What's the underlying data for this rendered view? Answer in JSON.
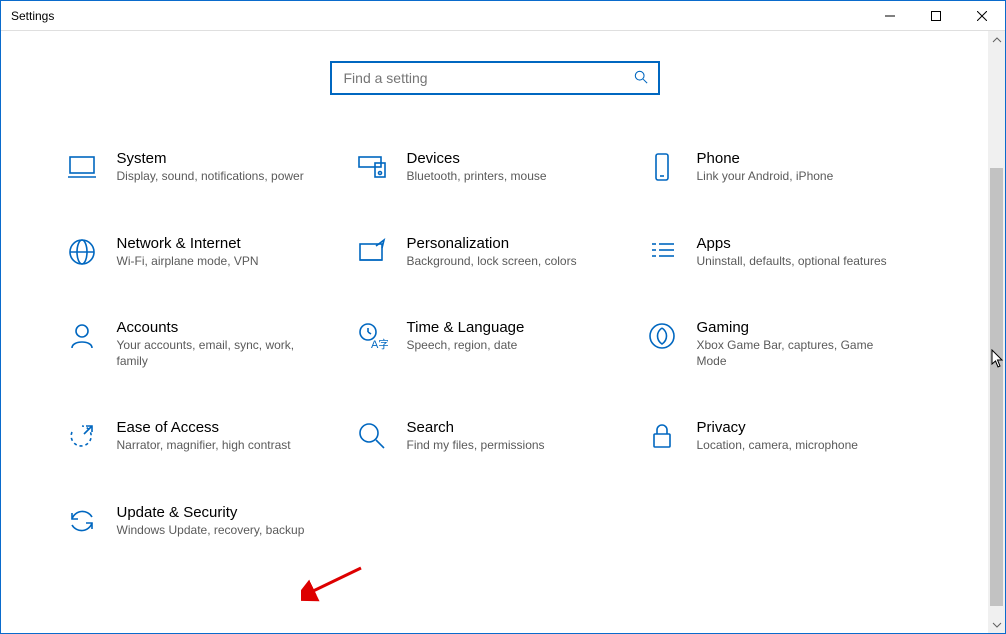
{
  "window": {
    "title": "Settings"
  },
  "search": {
    "placeholder": "Find a setting"
  },
  "items": [
    {
      "title": "System",
      "desc": "Display, sound, notifications, power"
    },
    {
      "title": "Devices",
      "desc": "Bluetooth, printers, mouse"
    },
    {
      "title": "Phone",
      "desc": "Link your Android, iPhone"
    },
    {
      "title": "Network & Internet",
      "desc": "Wi-Fi, airplane mode, VPN"
    },
    {
      "title": "Personalization",
      "desc": "Background, lock screen, colors"
    },
    {
      "title": "Apps",
      "desc": "Uninstall, defaults, optional features"
    },
    {
      "title": "Accounts",
      "desc": "Your accounts, email, sync, work, family"
    },
    {
      "title": "Time & Language",
      "desc": "Speech, region, date"
    },
    {
      "title": "Gaming",
      "desc": "Xbox Game Bar, captures, Game Mode"
    },
    {
      "title": "Ease of Access",
      "desc": "Narrator, magnifier, high contrast"
    },
    {
      "title": "Search",
      "desc": "Find my files, permissions"
    },
    {
      "title": "Privacy",
      "desc": "Location, camera, microphone"
    },
    {
      "title": "Update & Security",
      "desc": "Windows Update, recovery, backup"
    }
  ]
}
